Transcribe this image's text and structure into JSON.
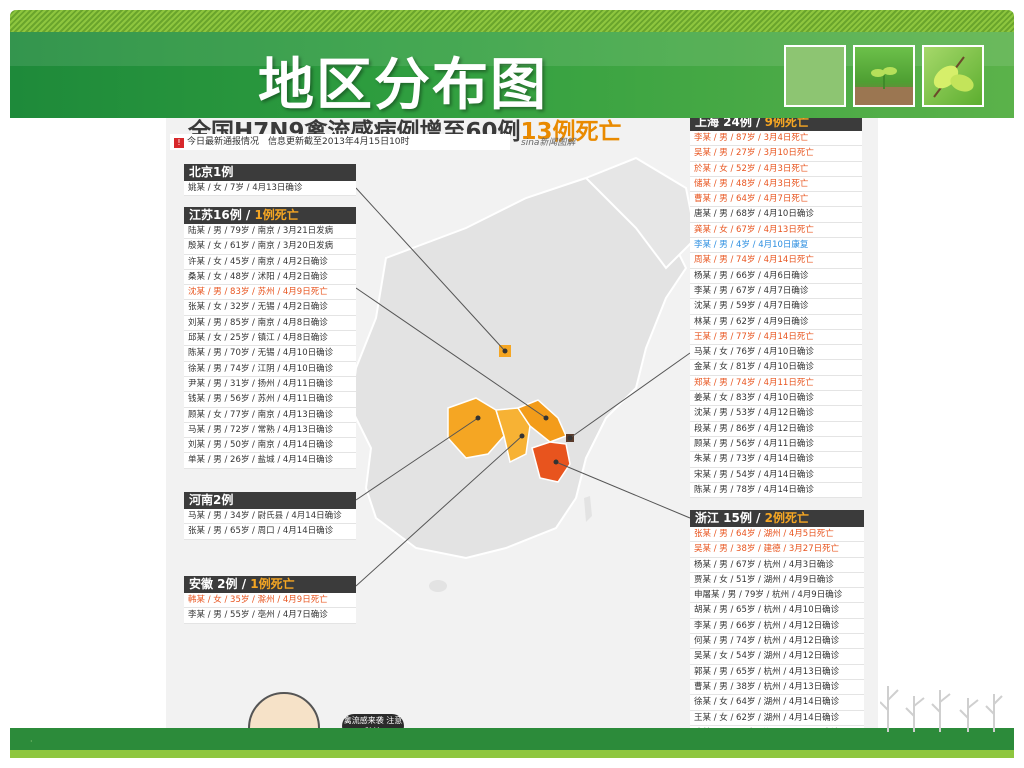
{
  "slide": {
    "title": "地区分布图"
  },
  "infographic": {
    "headline_main": "全国H7N9禽流感病例增至60例",
    "headline_accent": "13例死亡",
    "update_note": "今日最新通报情况　信息更新截至2013年4月15日10时",
    "source": "sina新闻图解",
    "mascot_bubble": "禽流感来袭 注意防护"
  },
  "panels": {
    "beijing": {
      "title": "北京1例",
      "rows": [
        {
          "text": "姚某 / 女 / 7岁 / 4月13日确诊",
          "status": "normal"
        }
      ]
    },
    "jiangsu": {
      "title": "江苏16例 / ",
      "deaths": "1例死亡",
      "rows": [
        {
          "text": "陆某 / 男 / 79岁 / 南京 / 3月21日发病",
          "status": "normal"
        },
        {
          "text": "殷某 / 女 / 61岁 / 南京 / 3月20日发病",
          "status": "normal"
        },
        {
          "text": "许某 / 女 / 45岁 / 南京 / 4月2日确诊",
          "status": "normal"
        },
        {
          "text": "桑某 / 女 / 48岁 / 沭阳 / 4月2日确诊",
          "status": "normal"
        },
        {
          "text": "沈某 / 男 / 83岁 / 苏州 / 4月9日死亡",
          "status": "dead"
        },
        {
          "text": "张某 / 女 / 32岁 / 无锡 / 4月2日确诊",
          "status": "normal"
        },
        {
          "text": "刘某 / 男 / 85岁 / 南京 / 4月8日确诊",
          "status": "normal"
        },
        {
          "text": "邱某 / 女 / 25岁 / 镇江 / 4月8日确诊",
          "status": "normal"
        },
        {
          "text": "陈某 / 男 / 70岁 / 无锡 / 4月10日确诊",
          "status": "normal"
        },
        {
          "text": "徐某 / 男 / 74岁 / 江阴 / 4月10日确诊",
          "status": "normal"
        },
        {
          "text": "尹某 / 男 / 31岁 / 扬州 / 4月11日确诊",
          "status": "normal"
        },
        {
          "text": "钱某 / 男 / 56岁 / 苏州 / 4月11日确诊",
          "status": "normal"
        },
        {
          "text": "顾某 / 女 / 77岁 / 南京 / 4月13日确诊",
          "status": "normal"
        },
        {
          "text": "马某 / 男 / 72岁 / 常熟 / 4月13日确诊",
          "status": "normal"
        },
        {
          "text": "刘某 / 男 / 50岁 / 南京 / 4月14日确诊",
          "status": "normal"
        },
        {
          "text": "单某 / 男 / 26岁 / 盐城 / 4月14日确诊",
          "status": "normal"
        }
      ]
    },
    "henan": {
      "title": "河南2例",
      "rows": [
        {
          "text": "马某 / 男 / 34岁 / 尉氏县 / 4月14日确诊",
          "status": "normal"
        },
        {
          "text": "张某 / 男 / 65岁 / 周口 / 4月14日确诊",
          "status": "normal"
        }
      ]
    },
    "anhui": {
      "title": "安徽 2例 / ",
      "deaths": "1例死亡",
      "rows": [
        {
          "text": "韩某 / 女 / 35岁 / 滁州 / 4月9日死亡",
          "status": "dead"
        },
        {
          "text": "李某 / 男 / 55岁 / 亳州 / 4月7日确诊",
          "status": "normal"
        }
      ]
    },
    "shanghai": {
      "title": "上海 24例 / ",
      "deaths": "9例死亡",
      "rows": [
        {
          "text": "李某 / 男 / 87岁 / 3月4日死亡",
          "status": "dead"
        },
        {
          "text": "吴某 / 男 / 27岁 / 3月10日死亡",
          "status": "dead"
        },
        {
          "text": "於某 / 女 / 52岁 / 4月3日死亡",
          "status": "dead"
        },
        {
          "text": "储某 / 男 / 48岁 / 4月3日死亡",
          "status": "dead"
        },
        {
          "text": "曹某 / 男 / 64岁 / 4月7日死亡",
          "status": "dead"
        },
        {
          "text": "唐某 / 男 / 68岁 / 4月10日确诊",
          "status": "normal"
        },
        {
          "text": "龚某 / 女 / 67岁 / 4月13日死亡",
          "status": "dead"
        },
        {
          "text": "李某 / 男 / 4岁 / 4月10日康复",
          "status": "rec"
        },
        {
          "text": "周某 / 男 / 74岁 / 4月14日死亡",
          "status": "dead"
        },
        {
          "text": "杨某 / 男 / 66岁 / 4月6日确诊",
          "status": "normal"
        },
        {
          "text": "李某 / 男 / 67岁 / 4月7日确诊",
          "status": "normal"
        },
        {
          "text": "沈某 / 男 / 59岁 / 4月7日确诊",
          "status": "normal"
        },
        {
          "text": "林某 / 男 / 62岁 / 4月9日确诊",
          "status": "normal"
        },
        {
          "text": "王某 / 男 / 77岁 / 4月14日死亡",
          "status": "dead"
        },
        {
          "text": "马某 / 女 / 76岁 / 4月10日确诊",
          "status": "normal"
        },
        {
          "text": "金某 / 女 / 81岁 / 4月10日确诊",
          "status": "normal"
        },
        {
          "text": "郑某 / 男 / 74岁 / 4月11日死亡",
          "status": "dead"
        },
        {
          "text": "姜某 / 女 / 83岁 / 4月10日确诊",
          "status": "normal"
        },
        {
          "text": "沈某 / 男 / 53岁 / 4月12日确诊",
          "status": "normal"
        },
        {
          "text": "段某 / 男 / 86岁 / 4月12日确诊",
          "status": "normal"
        },
        {
          "text": "顾某 / 男 / 56岁 / 4月11日确诊",
          "status": "normal"
        },
        {
          "text": "朱某 / 男 / 73岁 / 4月14日确诊",
          "status": "normal"
        },
        {
          "text": "宋某 / 男 / 54岁 / 4月14日确诊",
          "status": "normal"
        },
        {
          "text": "陈某 / 男 / 78岁 / 4月14日确诊",
          "status": "normal"
        }
      ]
    },
    "zhejiang": {
      "title": "浙江  15例 / ",
      "deaths": "2例死亡",
      "rows": [
        {
          "text": "张某 / 男 / 64岁 / 湖州 / 4月5日死亡",
          "status": "dead"
        },
        {
          "text": "吴某 / 男 / 38岁 / 建德 / 3月27日死亡",
          "status": "dead"
        },
        {
          "text": "杨某 / 男 / 67岁 / 杭州 / 4月3日确诊",
          "status": "normal"
        },
        {
          "text": "贾某 / 女 / 51岁 / 湖州 / 4月9日确诊",
          "status": "normal"
        },
        {
          "text": "申屠某 / 男 / 79岁 / 杭州 / 4月9日确诊",
          "status": "normal"
        },
        {
          "text": "胡某 / 男 / 65岁 / 杭州 / 4月10日确诊",
          "status": "normal"
        },
        {
          "text": "李某 / 男 / 66岁 / 杭州 / 4月12日确诊",
          "status": "normal"
        },
        {
          "text": "何某 / 男 / 74岁 / 杭州 / 4月12日确诊",
          "status": "normal"
        },
        {
          "text": "吴某 / 女 / 54岁 / 湖州 / 4月12日确诊",
          "status": "normal"
        },
        {
          "text": "郭某 / 男 / 65岁 / 杭州 / 4月13日确诊",
          "status": "normal"
        },
        {
          "text": "曹某 / 男 / 38岁 / 杭州 / 4月13日确诊",
          "status": "normal"
        },
        {
          "text": "徐某 / 女 / 64岁 / 湖州 / 4月14日确诊",
          "status": "normal"
        },
        {
          "text": "王某 / 女 / 62岁 / 湖州 / 4月14日确诊",
          "status": "normal"
        },
        {
          "text": "陈某 / 男 / 75岁 / 湖州 / 4月14日确诊",
          "status": "normal"
        }
      ]
    }
  },
  "colors": {
    "header_green": "#2f9e3f",
    "death_orange": "#e8541e",
    "accent_orange": "#f5a623",
    "recovered_blue": "#2a8de0"
  }
}
